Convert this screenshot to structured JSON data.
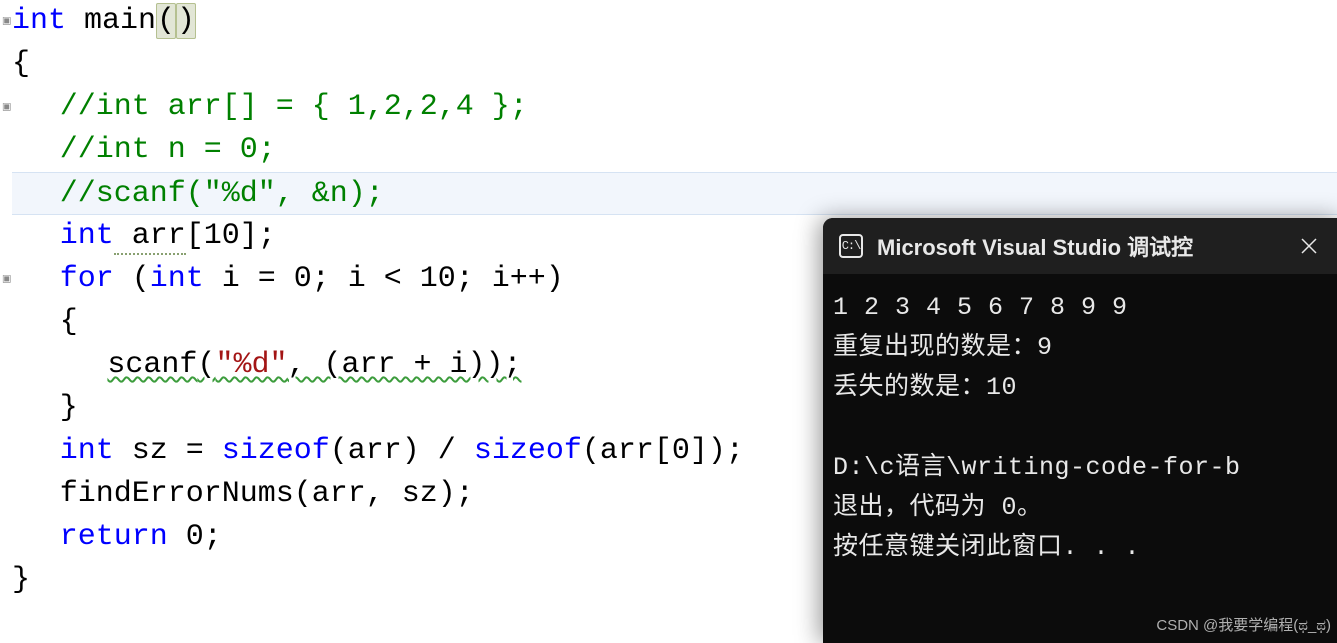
{
  "code": {
    "l1": {
      "kw1": "int",
      "fn": " main",
      "parens": "()"
    },
    "l2": "{",
    "l3": "//int arr[] = { 1,2,2,4 };",
    "l4": "//int n = 0;",
    "l5": "//scanf(\"%d\", &n);",
    "l6": {
      "kw": "int",
      "arr": " arr",
      "rest": "[10];"
    },
    "l7": {
      "kw1": "for",
      "p1": " (",
      "kw2": "int",
      "rest": " i = 0; i < 10; i++)"
    },
    "l8": "{",
    "l9": {
      "fn": "scanf",
      "p1": "(",
      "str": "\"%d\"",
      "p2": ", (arr + i));"
    },
    "l10": "}",
    "l11": {
      "kw": "int",
      "p1": " sz = ",
      "fn1": "sizeof",
      "p2": "(arr) / ",
      "fn2": "sizeof",
      "p3": "(arr[0]);"
    },
    "l12": {
      "fn": "findErrorNums",
      "rest": "(arr, sz);"
    },
    "l13": {
      "kw": "return",
      "rest": " 0;"
    },
    "l14": "}"
  },
  "terminal": {
    "title": "Microsoft Visual Studio 调试控",
    "input_line": "1 2 3 4 5 6 7 8 9 9",
    "out1": "重复出现的数是：9",
    "out2": "丢失的数是：10",
    "path": "D:\\c语言\\writing-code-for-b",
    "exit": "退出，代码为 0。",
    "press": "按任意键关闭此窗口. . .",
    "watermark": "CSDN @我要学编程(ಥ_ಥ)"
  }
}
